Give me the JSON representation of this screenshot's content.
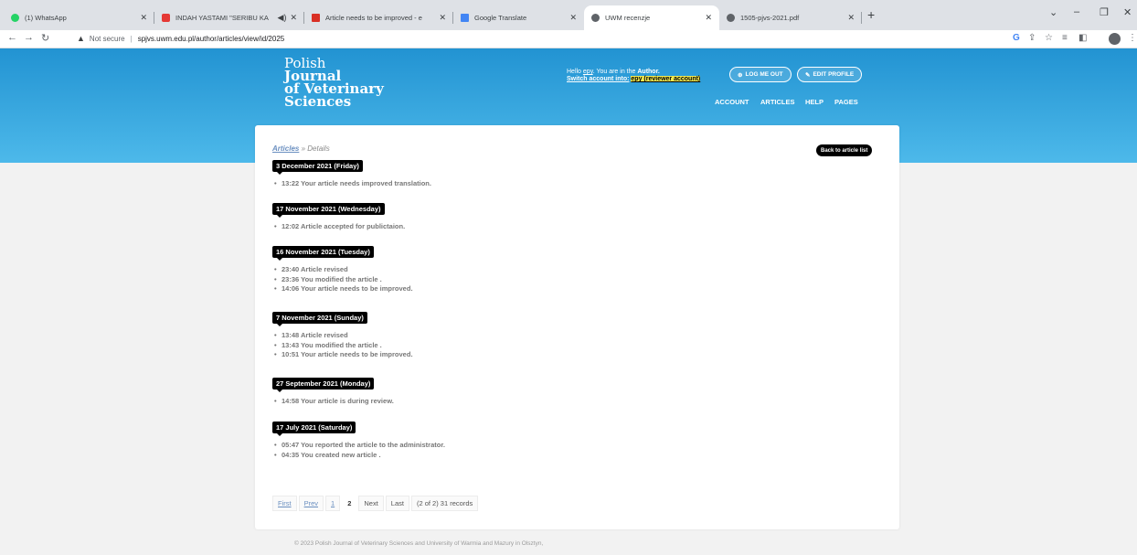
{
  "browser": {
    "tabs": [
      {
        "label": "(1) WhatsApp",
        "color": "#25d366"
      },
      {
        "label": "INDAH YASTAMI \"SERIBU KA",
        "color": "#e53935"
      },
      {
        "label": "Article needs to be improved - e",
        "color": "#d93025"
      },
      {
        "label": "Google Translate",
        "color": "#4285f4"
      },
      {
        "label": "UWM recenzje",
        "color": "#5f6368"
      },
      {
        "label": "1505-pjvs-2021.pdf",
        "color": "#5f6368"
      }
    ],
    "address": {
      "security": "Not secure",
      "url": "spjvs.uwm.edu.pl/author/articles/view/id/2025"
    }
  },
  "header": {
    "logo": {
      "line1": "Polish",
      "line2": "Journal",
      "line3": "of Veterinary",
      "line4": "Sciences"
    },
    "greeting": {
      "hello": "Hello",
      "user": "epy",
      "role_text": ". You are in the",
      "role": "Author.",
      "switch_text": "Switch account into:",
      "switch_target": "epy (reviewer account)"
    },
    "buttons": {
      "logout": "LOG ME OUT",
      "edit_profile": "EDIT PROFILE"
    },
    "nav": [
      "ACCOUNT",
      "ARTICLES",
      "HELP",
      "PAGES"
    ]
  },
  "breadcrumb": {
    "link": "Articles",
    "current": " » Details"
  },
  "back_button": "Back to article list",
  "timeline": [
    {
      "date": "3 December 2021 (Friday)",
      "entries": [
        "13:22 Your article needs improved translation."
      ]
    },
    {
      "date": "17 November 2021 (Wednesday)",
      "entries": [
        "12:02 Article accepted for publictaion."
      ]
    },
    {
      "date": "16 November 2021 (Tuesday)",
      "entries": [
        "23:40 Article revised",
        "23:36 You modified the article .",
        "14:06 Your article needs to be improved."
      ]
    },
    {
      "date": "7 November 2021 (Sunday)",
      "entries": [
        "13:48 Article revised",
        "13:43 You modified the article .",
        "10:51 Your article needs to be improved."
      ]
    },
    {
      "date": "27 September 2021 (Monday)",
      "entries": [
        "14:58 Your article is during review."
      ]
    },
    {
      "date": "17 July 2021 (Saturday)",
      "entries": [
        "05:47 You reported the article to the administrator.",
        "04:35 You created new article ."
      ]
    }
  ],
  "pagination": {
    "first": "First",
    "prev": "Prev",
    "page1": "1",
    "page2": "2",
    "next": "Next",
    "last": "Last",
    "info": "(2 of 2) 31 records"
  },
  "footer": "© 2023 Polish Journal of Veterinary Sciences and University of Warmia and Mazury in Olsztyn,"
}
